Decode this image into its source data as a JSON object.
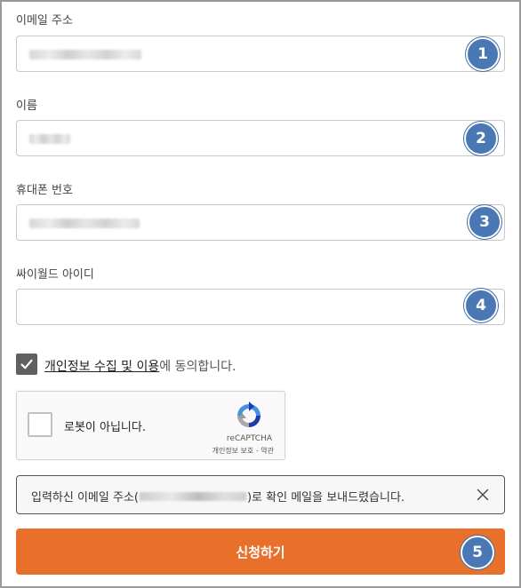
{
  "form": {
    "email": {
      "label": "이메일 주소",
      "value": "",
      "badge": "1"
    },
    "name": {
      "label": "이름",
      "value": "",
      "badge": "2"
    },
    "phone": {
      "label": "휴대폰 번호",
      "value": "",
      "badge": "3"
    },
    "cyworld_id": {
      "label": "싸이월드 아이디",
      "value": "",
      "badge": "4"
    }
  },
  "consent": {
    "checked": true,
    "link_text": "개인정보 수집 및 이용",
    "suffix_text": "에 동의합니다."
  },
  "captcha": {
    "label": "로봇이 아닙니다.",
    "brand": "reCAPTCHA",
    "privacy": "개인정보 보호",
    "separator": " - ",
    "terms": "약관"
  },
  "notice": {
    "prefix": "입력하신 이메일 주소(",
    "suffix": ")로 확인 메일을 보내드렸습니다.",
    "close_icon": "close-icon"
  },
  "submit": {
    "label": "신청하기",
    "badge": "5"
  },
  "colors": {
    "badge": "#4a78b5",
    "submit": "#e8702a",
    "checkbox": "#606060"
  }
}
